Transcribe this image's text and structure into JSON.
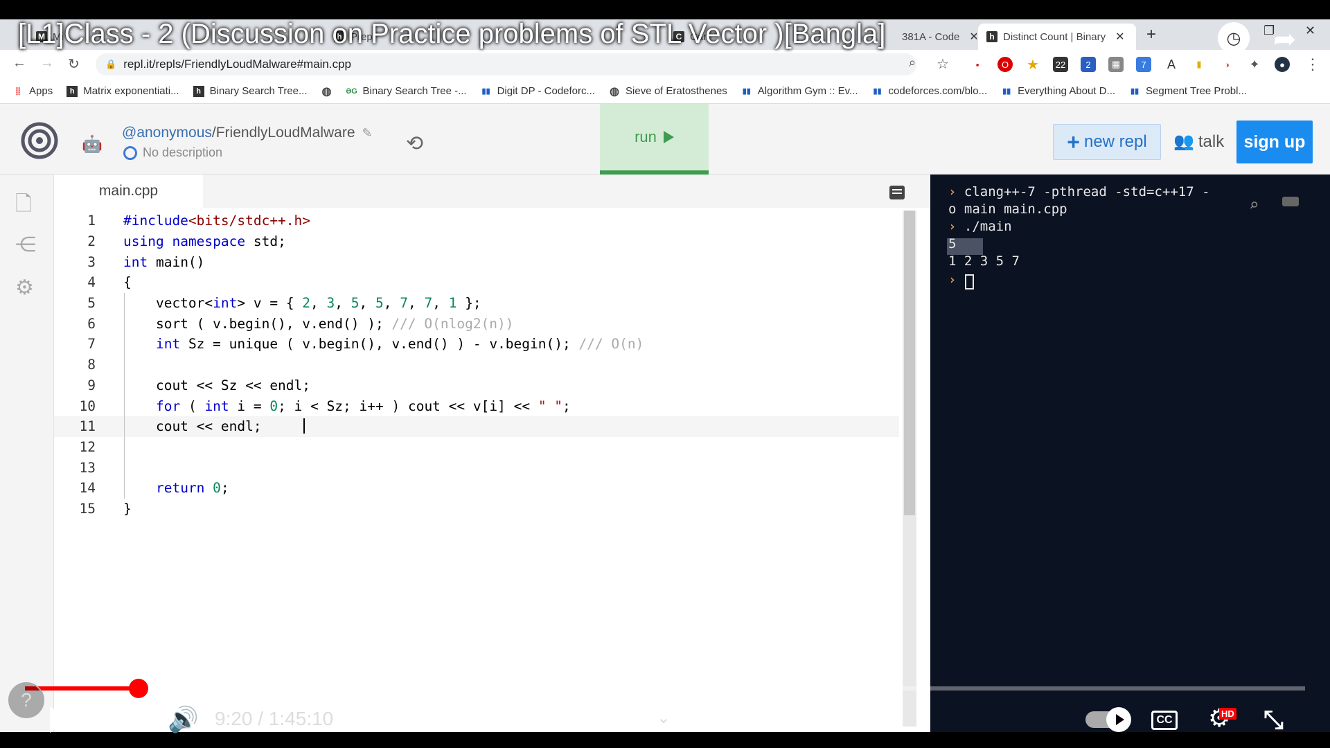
{
  "video": {
    "title": "[L1]Class - 2 (Discussion on Practice problems of STL Vector )[Bangla]",
    "time_display": "9:20 / 1:45:10",
    "progress_fraction": 0.089
  },
  "browser": {
    "tabs": [
      {
        "label": "Mi",
        "icon": "M"
      },
      {
        "label": "Prep",
        "icon": "h"
      },
      {
        "label": "Can",
        "icon": "C"
      },
      {
        "label": "381A - Code",
        "icon": "C"
      },
      {
        "label": "Distinct Count | Binary",
        "icon": "h"
      }
    ],
    "url": "repl.it/repls/FriendlyLoudMalware#main.cpp",
    "bookmarks": [
      {
        "label": "Apps",
        "icon": "apps-grid-icon"
      },
      {
        "label": "Matrix exponentiati...",
        "icon": "h"
      },
      {
        "label": "Binary Search Tree...",
        "icon": "h"
      },
      {
        "label": "",
        "icon": "globe-icon"
      },
      {
        "label": "Binary Search Tree -...",
        "icon": "gfg-icon"
      },
      {
        "label": "Digit DP - Codeforc...",
        "icon": "bars-icon"
      },
      {
        "label": "Sieve of Eratosthenes",
        "icon": "globe-icon"
      },
      {
        "label": "Algorithm Gym :: Ev...",
        "icon": "bars-icon"
      },
      {
        "label": "codeforces.com/blo...",
        "icon": "bars-icon"
      },
      {
        "label": "Everything About D...",
        "icon": "bars-icon"
      },
      {
        "label": "Segment Tree Probl...",
        "icon": "bars-icon"
      }
    ],
    "ext_badges": [
      "22",
      "2",
      "7"
    ]
  },
  "repl": {
    "owner": "@anonymous",
    "sep": "/",
    "name": "FriendlyLoudMalware",
    "description": "No description",
    "run_label": "run",
    "new_repl_label": "new repl",
    "talk_label": "talk",
    "signup_label": "sign up",
    "file_tab": "main.cpp"
  },
  "code_lines": [
    "#include<bits/stdc++.h>",
    "using namespace std;",
    "int main()",
    "{",
    "    vector<int> v = { 2, 3, 5, 5, 7, 7, 1 };",
    "    sort ( v.begin(), v.end() ); /// O(nlog2(n))",
    "    int Sz = unique ( v.begin(), v.end() ) - v.begin(); /// O(n)",
    "",
    "    cout << Sz << endl;",
    "    for ( int i = 0; i < Sz; i++ ) cout << v[i] << \" \";",
    "    cout << endl;",
    "",
    "",
    "    return 0;",
    "}"
  ],
  "console": {
    "cmd1_a": "clang++-7 -pthread -std=c++17 -",
    "cmd1_b": "o main main.cpp",
    "cmd2": "./main",
    "out1": "5",
    "out2": "1 2 3 5 7",
    "prompt": "›"
  }
}
